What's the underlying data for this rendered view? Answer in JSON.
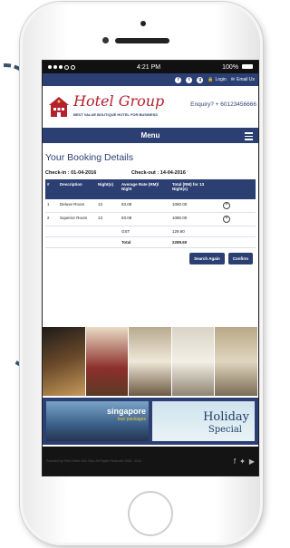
{
  "status": {
    "time": "4:21 PM",
    "battery": "100%"
  },
  "topbar": {
    "social": [
      "f",
      "t",
      "g"
    ],
    "login": "Login",
    "email": "Email Us"
  },
  "header": {
    "brand": "Hotel Group",
    "tagline": "BEST VALUE BOUTIQUE HOTEL FOR BUSINESS",
    "enquiry": "Enquiry? + 60123456666"
  },
  "menu": {
    "label": "Menu"
  },
  "booking": {
    "title": "Your Booking Details",
    "checkin": "Check-in : 01-04-2016",
    "checkout": "Check-out : 14-04-2016",
    "columns": [
      "#",
      "Description",
      "Night(s)",
      "Average Rate (RM)/ Night",
      "Total (RM) for 13 Night(s)"
    ],
    "rows": [
      {
        "num": "1",
        "desc": "Deluxe Room",
        "nights": "13",
        "rate": "83.08",
        "total": "1080.00"
      },
      {
        "num": "2",
        "desc": "Superior Room",
        "nights": "13",
        "rate": "83.08",
        "total": "1080.00"
      }
    ],
    "gst_label": "GST",
    "gst_value": "129.60",
    "total_label": "Total",
    "total_value": "2289.60",
    "search_again": "Search Again",
    "confirm": "Confirm"
  },
  "banners": {
    "sg_title": "singapore",
    "sg_sub": "tour packages",
    "holiday": "Holiday",
    "special": "Special"
  },
  "footer": {
    "copyright": "Powered by First Online Sdn. Bhd. All Rights Reserved 1998 - 2016"
  },
  "colors": {
    "primary": "#2b3f73",
    "brand": "#b3212e"
  }
}
